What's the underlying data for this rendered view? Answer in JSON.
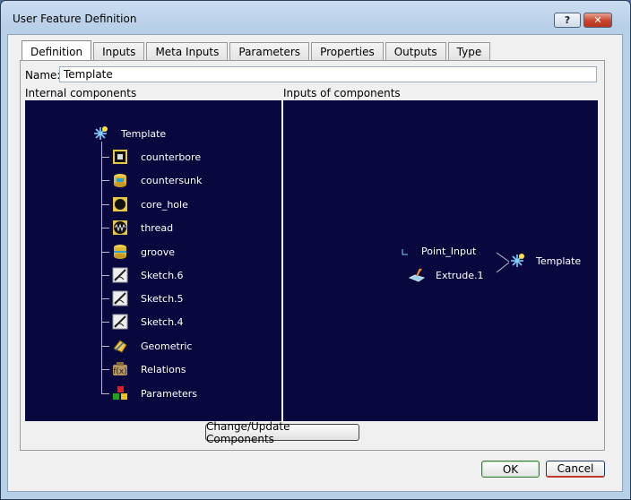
{
  "window": {
    "title": "User Feature Definition",
    "help_label": "?",
    "close_label": "✕"
  },
  "tabs": [
    {
      "label": "Definition",
      "active": true
    },
    {
      "label": "Inputs"
    },
    {
      "label": "Meta Inputs"
    },
    {
      "label": "Parameters"
    },
    {
      "label": "Properties"
    },
    {
      "label": "Outputs"
    },
    {
      "label": "Type"
    }
  ],
  "name_field": {
    "label": "Name:",
    "value": "Template"
  },
  "internal": {
    "label": "Internal components",
    "root": {
      "label": "Template",
      "icon": "template-icon"
    },
    "items": [
      {
        "label": "counterbore",
        "icon": "counterbore-icon"
      },
      {
        "label": "countersunk",
        "icon": "countersunk-icon"
      },
      {
        "label": "core_hole",
        "icon": "core-hole-icon"
      },
      {
        "label": "thread",
        "icon": "thread-icon"
      },
      {
        "label": "groove",
        "icon": "groove-icon"
      },
      {
        "label": "Sketch.6",
        "icon": "sketch-icon"
      },
      {
        "label": "Sketch.5",
        "icon": "sketch-icon"
      },
      {
        "label": "Sketch.4",
        "icon": "sketch-icon"
      },
      {
        "label": "Geometric",
        "icon": "geometric-icon"
      },
      {
        "label": "Relations",
        "icon": "relations-icon"
      },
      {
        "label": "Parameters",
        "icon": "parameters-icon"
      }
    ]
  },
  "inputs": {
    "label": "Inputs of components",
    "items": [
      {
        "label": "Point_Input",
        "icon": "point-icon"
      },
      {
        "label": "Extrude.1",
        "icon": "extrude-icon"
      }
    ],
    "target": {
      "label": "Template",
      "icon": "template-icon"
    }
  },
  "buttons": {
    "change": "Change/Update Components",
    "ok": "OK",
    "cancel": "Cancel"
  }
}
